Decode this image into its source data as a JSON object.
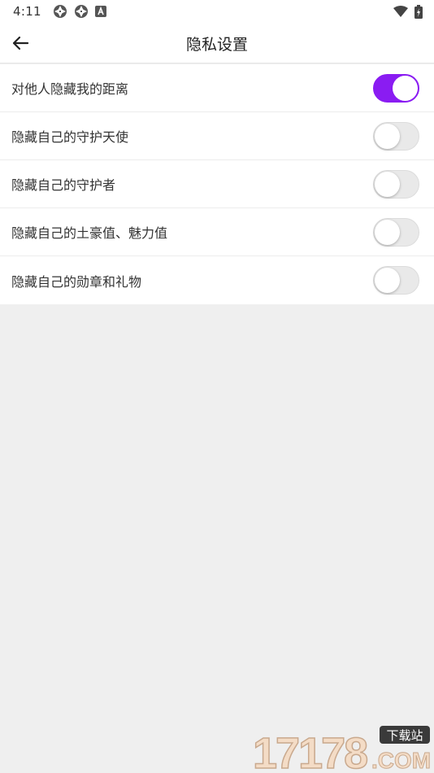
{
  "status_bar": {
    "time": "4:11",
    "left_icons": [
      "aperture-icon",
      "aperture-icon",
      "a-box-icon"
    ],
    "right_icons": [
      "wifi-icon",
      "battery-charging-icon"
    ]
  },
  "app_bar": {
    "back_icon": "arrow-left-icon",
    "title": "隐私设置"
  },
  "settings": [
    {
      "label": "对他人隐藏我的距离",
      "enabled": true
    },
    {
      "label": "隐藏自己的守护天使",
      "enabled": false
    },
    {
      "label": "隐藏自己的守护者",
      "enabled": false
    },
    {
      "label": "隐藏自己的土豪值、魅力值",
      "enabled": false
    },
    {
      "label": "隐藏自己的勋章和礼物",
      "enabled": false
    }
  ],
  "watermark": {
    "number": "17178",
    "tag": "下载站",
    "domain": ".COM"
  },
  "colors": {
    "accent": "#8a1cf2",
    "background": "#efefef",
    "surface": "#ffffff"
  }
}
